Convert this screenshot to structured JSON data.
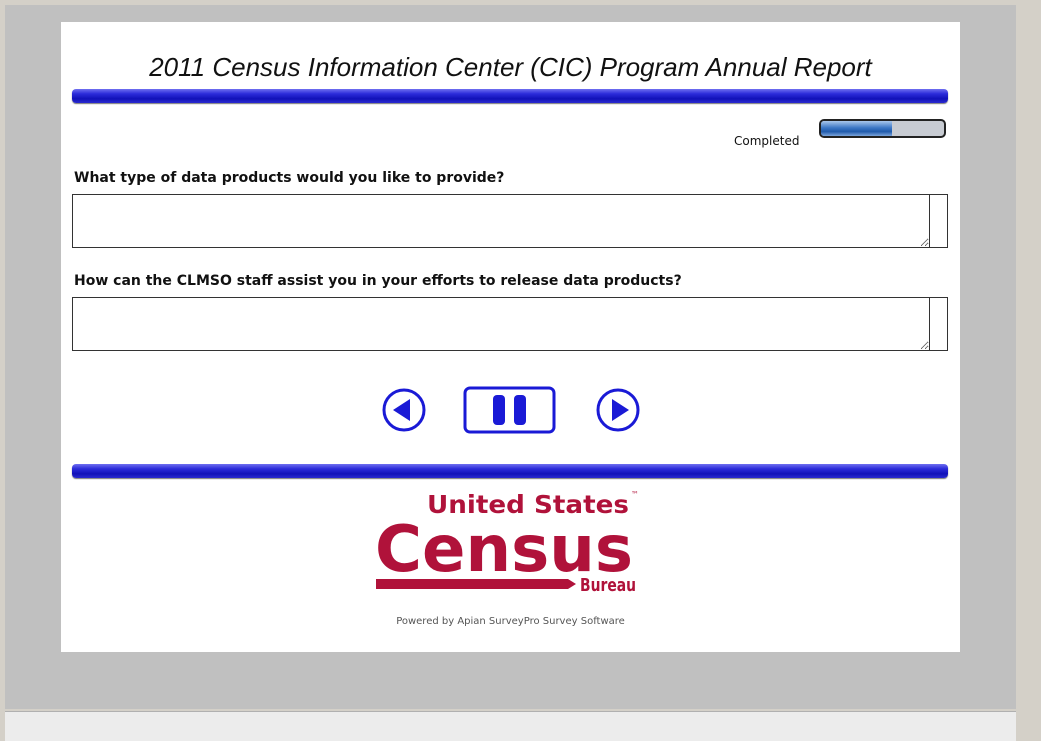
{
  "survey": {
    "title": "2011 Census Information Center (CIC) Program Annual Report",
    "progress_label": "Completed",
    "progress_fraction": 0.58
  },
  "questions": [
    {
      "text": "What type of data products would you like to provide?",
      "value": ""
    },
    {
      "text": "How can the CLMSO staff assist you in your efforts to release data products?",
      "value": ""
    }
  ],
  "navigation": {
    "back_icon": "back-arrow-icon",
    "pause_icon": "pause-icon",
    "next_icon": "next-arrow-icon"
  },
  "logo": {
    "line1": "United States",
    "trademark": "™",
    "line2": "Census",
    "line3": "Bureau"
  },
  "footer": {
    "text": "Powered by Apian SurveyPro Survey Software"
  },
  "colors": {
    "accent_blue": "#1a1ad6",
    "census_red": "#b0123a"
  }
}
